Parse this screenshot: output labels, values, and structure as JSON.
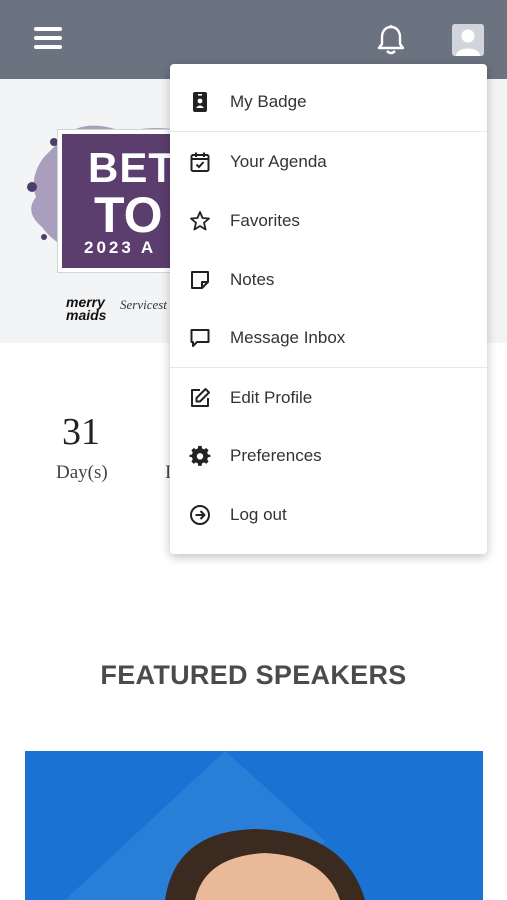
{
  "header": {
    "menu_icon": "hamburger-icon",
    "notifications_icon": "bell-icon",
    "profile_icon": "user-avatar-icon",
    "background": "#6b7280"
  },
  "hero": {
    "logo_line1": "BETT",
    "logo_line2": "TO",
    "logo_line3": "2023 A",
    "sponsor1": "merry maids",
    "sponsor2": "Servicest"
  },
  "countdown": {
    "days_value": "31",
    "days_label": "Day(s)",
    "next_label_fragment": "I"
  },
  "featured": {
    "title": "FEATURED SPEAKERS"
  },
  "dropdown": {
    "items": [
      {
        "label": "My Badge",
        "icon": "badge-icon"
      },
      {
        "label": "Your Agenda",
        "icon": "calendar-check-icon"
      },
      {
        "label": "Favorites",
        "icon": "star-icon"
      },
      {
        "label": "Notes",
        "icon": "sticky-note-icon"
      },
      {
        "label": "Message Inbox",
        "icon": "message-icon"
      },
      {
        "label": "Edit Profile",
        "icon": "edit-icon"
      },
      {
        "label": "Preferences",
        "icon": "gear-icon"
      },
      {
        "label": "Log out",
        "icon": "logout-icon"
      }
    ]
  },
  "colors": {
    "accent_purple": "#5b3d6e",
    "speaker_blue": "#1a73d2"
  }
}
